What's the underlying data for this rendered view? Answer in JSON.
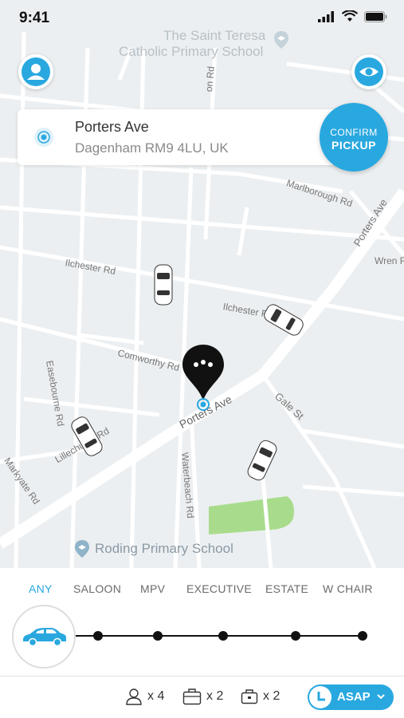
{
  "status_bar": {
    "time": "9:41"
  },
  "map": {
    "poi_top_line1": "The Saint Teresa",
    "poi_top_line2": "Catholic Primary School",
    "poi_bottom": "Roding Primary School",
    "streets": {
      "ilchester1": "Ilchester Rd",
      "ilchester2": "Ilchester Rd",
      "marlborough": "Marlborough Rd",
      "porters_ne": "Porters Ave",
      "porters_center": "Porters Ave",
      "wren": "Wren R",
      "comworthy": "Comworthy Rd",
      "gale": "Gale St",
      "easebourne": "Easebourne Rd",
      "lillechurch": "Lillechurch Rd",
      "markyate": "Markyate Rd",
      "waterbeach": "Waterbeach Rd",
      "on_rd": "on Rd"
    }
  },
  "pickup": {
    "title": "Porters Ave",
    "subtitle": "Dagenham RM9 4LU, UK",
    "confirm_line1": "CONFIRM",
    "confirm_line2": "PICKUP"
  },
  "vehicle_types": {
    "items": [
      "ANY",
      "SALOON",
      "MPV",
      "EXECUTIVE",
      "ESTATE",
      "W CHAIR"
    ],
    "selected": "ANY"
  },
  "footer": {
    "passengers": "x 4",
    "luggage": "x 2",
    "hand_luggage": "x 2",
    "when": "ASAP"
  },
  "colors": {
    "accent": "#29a8e0",
    "map_bg": "#eceff1",
    "road": "#ffffff",
    "park": "#a8dc8c"
  }
}
